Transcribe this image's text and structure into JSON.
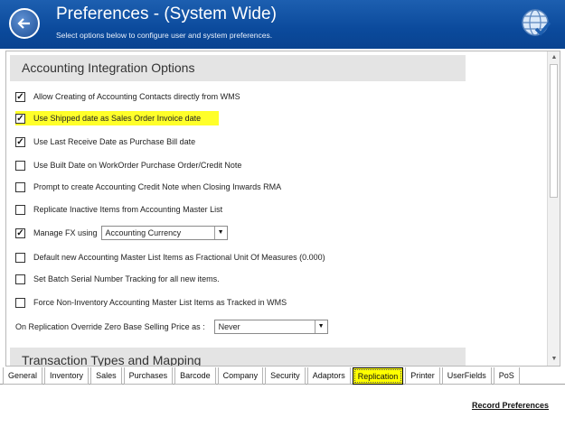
{
  "header": {
    "title": "Preferences - (System Wide)",
    "subtitle": "Select options below to configure user and system preferences.",
    "back_icon": "back-arrow-icon",
    "globe_icon": "globe-check-icon"
  },
  "sections": {
    "accounting": "Accounting Integration Options",
    "transactions": "Transaction Types and Mapping"
  },
  "options": [
    {
      "label": "Allow Creating of Accounting Contacts directly from WMS",
      "checked": true
    },
    {
      "label": "Use Shipped date as Sales Order Invoice date",
      "checked": true,
      "highlighted": true
    },
    {
      "label": "Use Last Receive Date as Purchase Bill date",
      "checked": true
    },
    {
      "label": "Use Built Date on WorkOrder Purchase Order/Credit Note",
      "checked": false
    },
    {
      "label": "Prompt to create Accounting Credit Note when Closing Inwards RMA",
      "checked": false
    },
    {
      "label": "Replicate Inactive Items from Accounting Master List",
      "checked": false
    },
    {
      "label": "Manage FX using",
      "checked": true,
      "select": "Accounting Currency"
    },
    {
      "label": "Default new Accounting Master List Items as Fractional Unit Of Measures (0.000)",
      "checked": false
    },
    {
      "label": "Set Batch Serial Number Tracking for all new items.",
      "checked": false
    },
    {
      "label": "Force Non-Inventory Accounting Master List Items as Tracked in WMS",
      "checked": false
    }
  ],
  "override": {
    "label": "On Replication Override Zero Base Selling Price as :",
    "value": "Never"
  },
  "tabs": [
    "General",
    "Inventory",
    "Sales",
    "Purchases",
    "Barcode",
    "Company",
    "Security",
    "Adaptors",
    "Replication",
    "Printer",
    "UserFields",
    "PoS"
  ],
  "active_tab": "Replication",
  "record_label": "Record Preferences",
  "colors": {
    "header": "#0b4a9c",
    "highlight": "#ffff2a",
    "section_bar": "#e4e4e4"
  }
}
